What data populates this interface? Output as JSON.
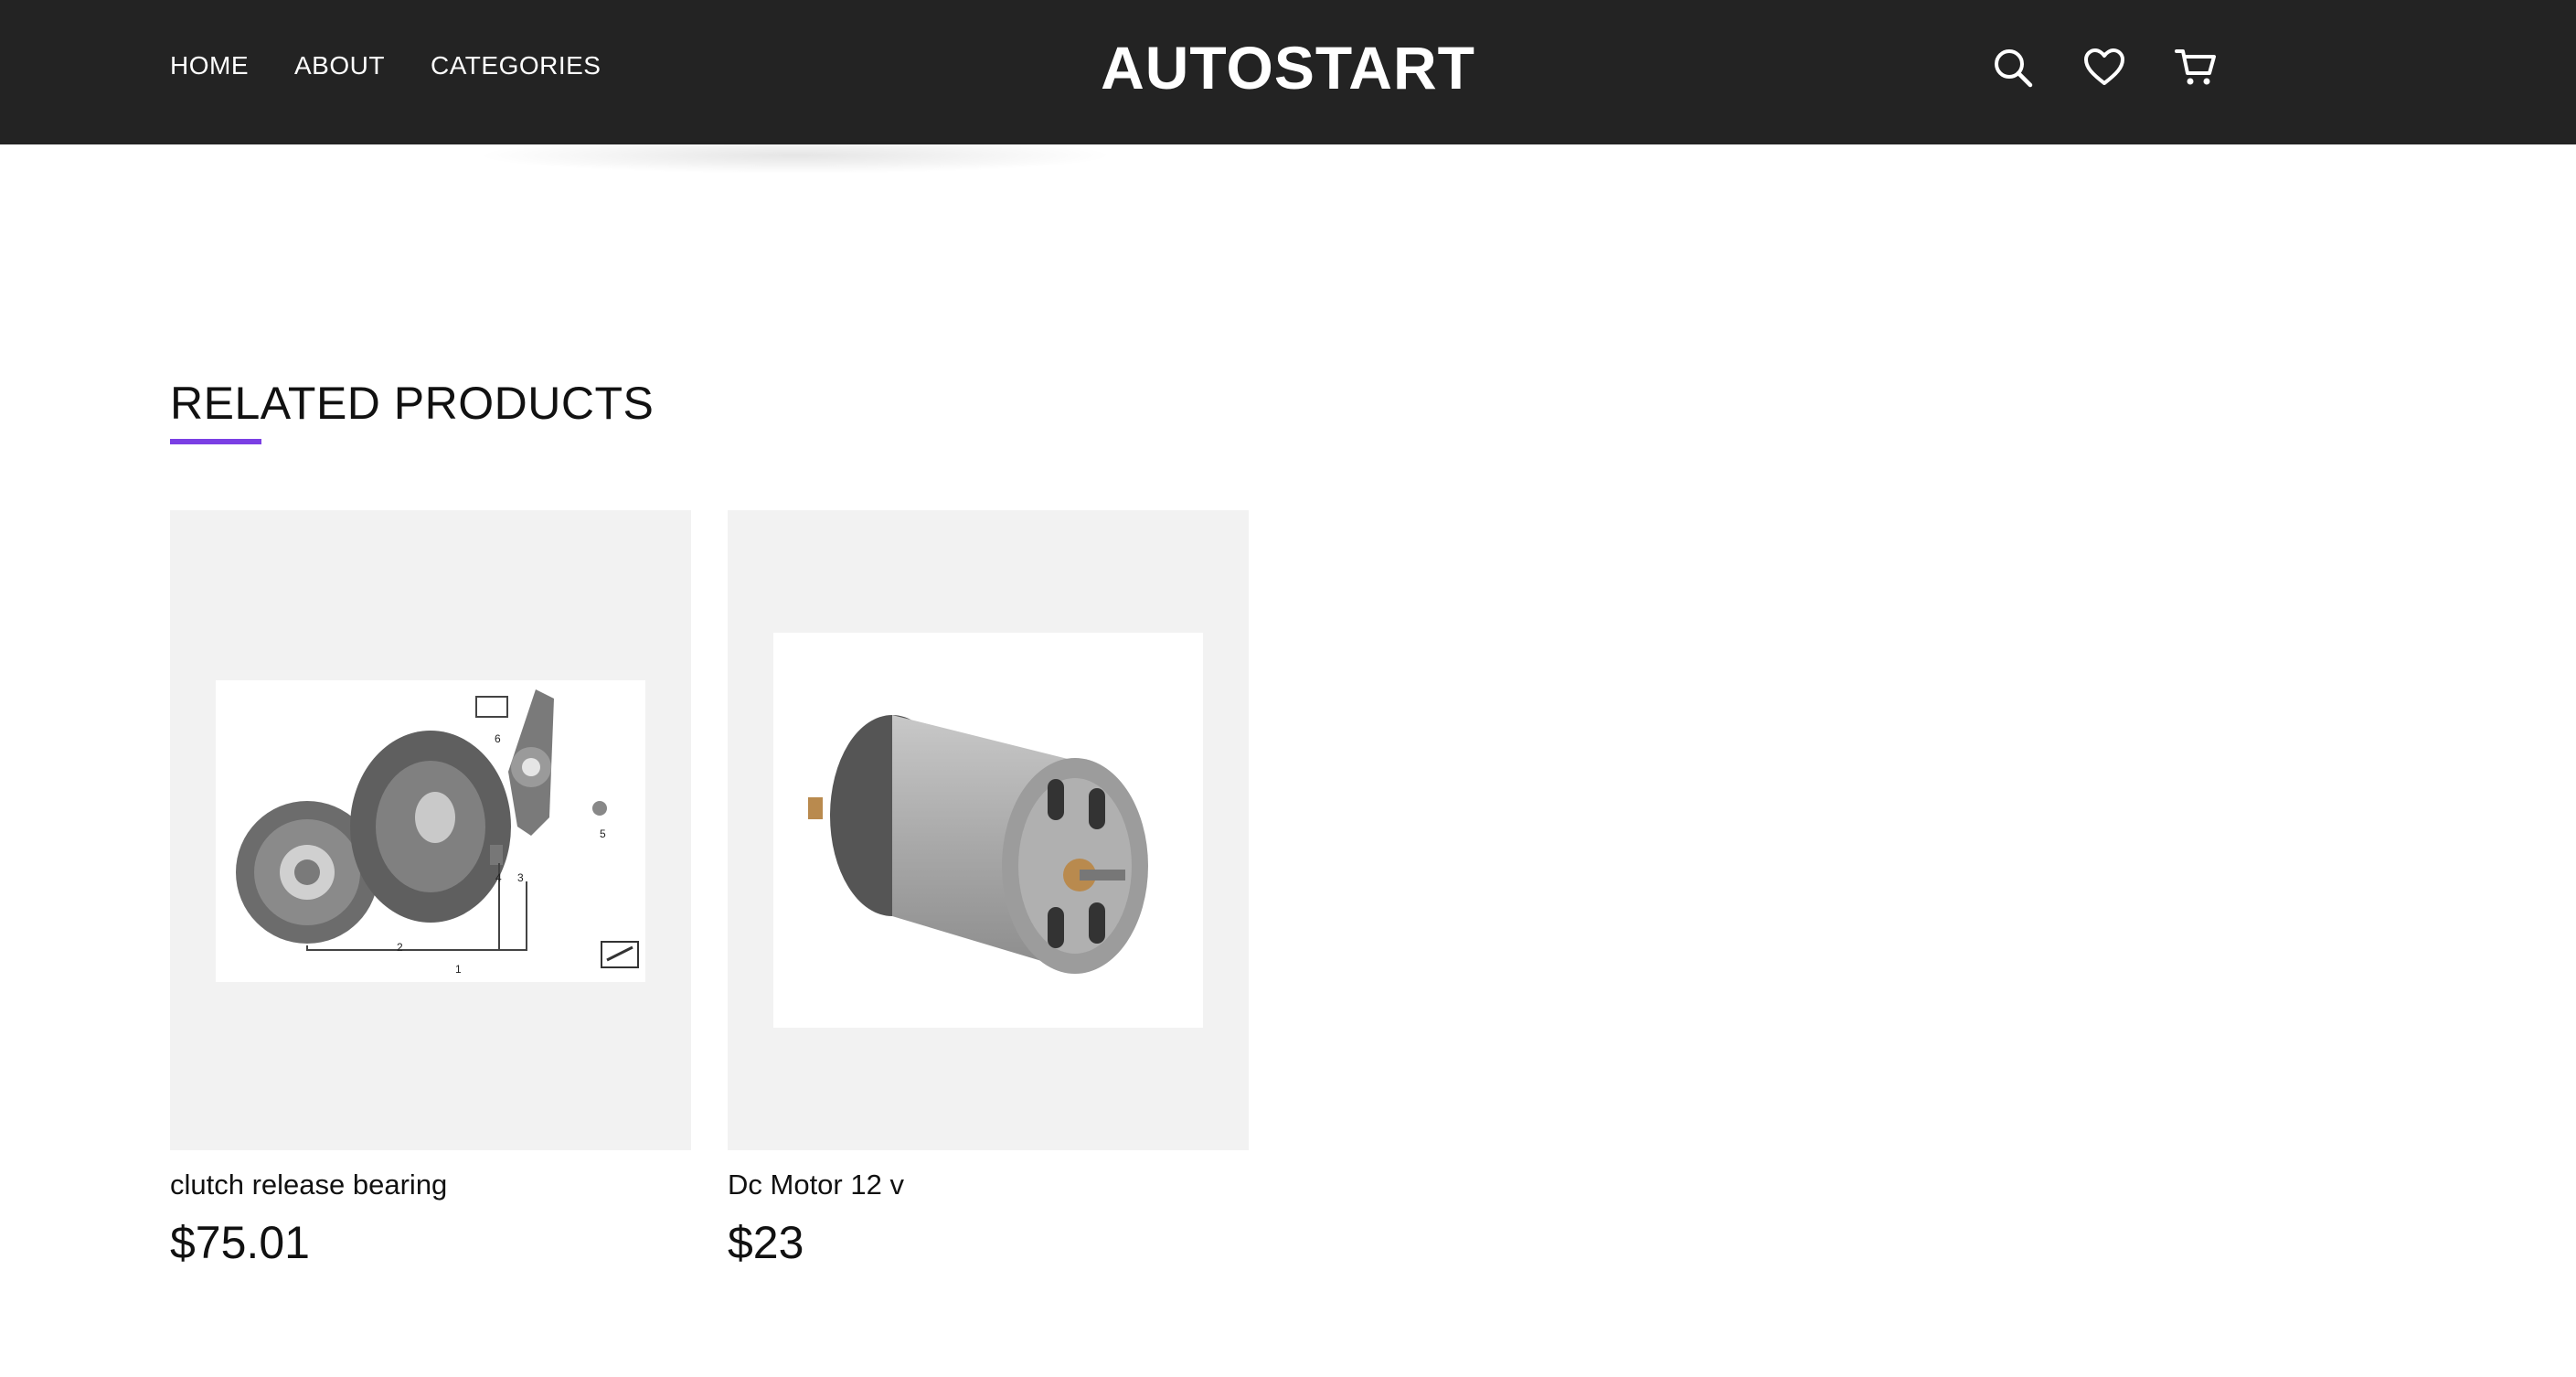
{
  "header": {
    "brand": "AUTOSTART",
    "nav": [
      {
        "label": "HOME"
      },
      {
        "label": "ABOUT"
      },
      {
        "label": "CATEGORIES"
      }
    ],
    "icons": [
      "search-icon",
      "heart-icon",
      "cart-icon"
    ]
  },
  "related": {
    "title": "RELATED PRODUCTS",
    "accent": "#7b3fe4",
    "products": [
      {
        "name": "clutch release bearing",
        "price": "$75.01",
        "image": "clutch-assembly-diagram"
      },
      {
        "name": "Dc Motor 12 v",
        "price": "$23",
        "image": "dc-motor-photo"
      }
    ]
  }
}
